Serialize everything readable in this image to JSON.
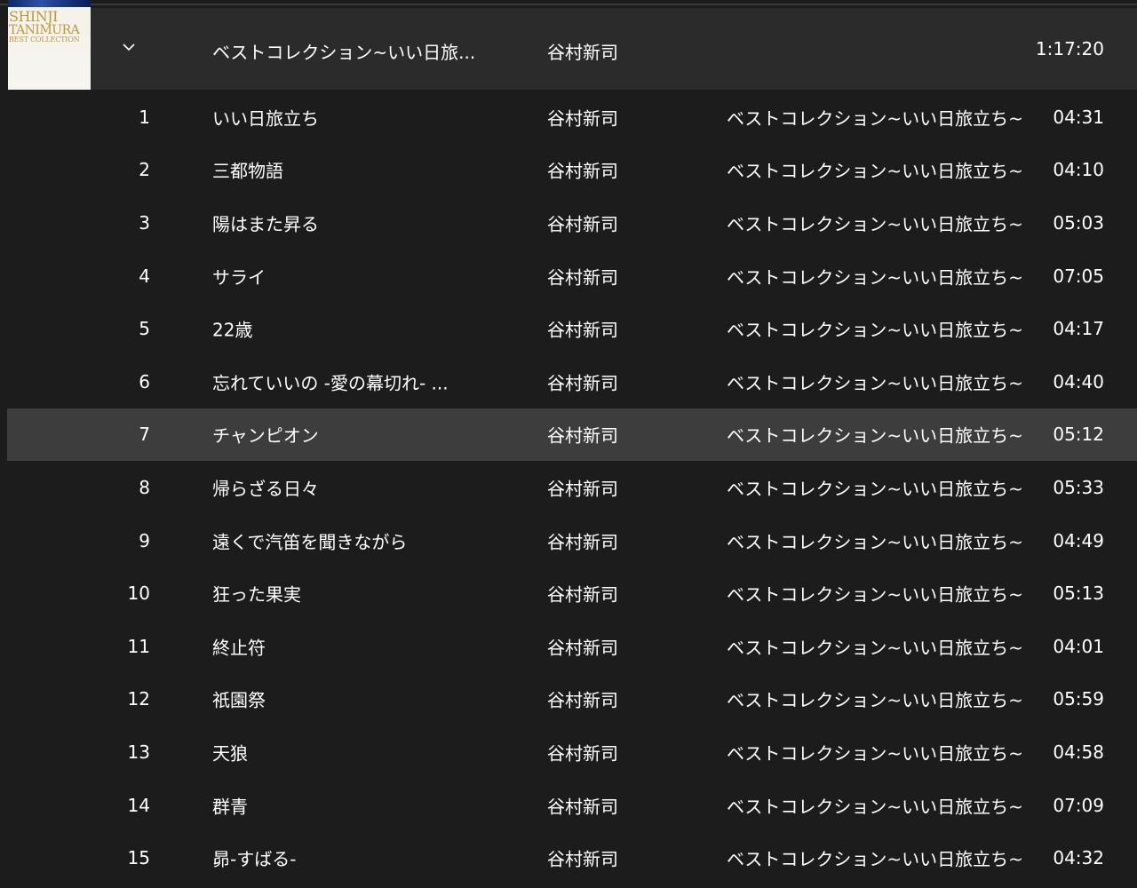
{
  "album": {
    "art_text": [
      "SHINJI",
      "TANIMURA",
      "BEST COLLECTION"
    ],
    "title": "ベストコレクション~いい日旅...",
    "artist": "谷村新司",
    "duration": "1:17:20",
    "expand_icon": "chevron-down-icon"
  },
  "columns": [
    "number",
    "title",
    "artist",
    "album",
    "duration"
  ],
  "selected_track": 7,
  "tracks": [
    {
      "number": "1",
      "title": "いい日旅立ち",
      "artist": "谷村新司",
      "album": "ベストコレクション~いい日旅立ち~",
      "duration": "04:31"
    },
    {
      "number": "2",
      "title": "三都物語",
      "artist": "谷村新司",
      "album": "ベストコレクション~いい日旅立ち~",
      "duration": "04:10"
    },
    {
      "number": "3",
      "title": "陽はまた昇る",
      "artist": "谷村新司",
      "album": "ベストコレクション~いい日旅立ち~",
      "duration": "05:03"
    },
    {
      "number": "4",
      "title": "サライ",
      "artist": "谷村新司",
      "album": "ベストコレクション~いい日旅立ち~",
      "duration": "07:05"
    },
    {
      "number": "5",
      "title": "22歳",
      "artist": "谷村新司",
      "album": "ベストコレクション~いい日旅立ち~",
      "duration": "04:17"
    },
    {
      "number": "6",
      "title": "忘れていいの -愛の幕切れ- ...",
      "artist": "谷村新司",
      "album": "ベストコレクション~いい日旅立ち~",
      "duration": "04:40"
    },
    {
      "number": "7",
      "title": "チャンピオン",
      "artist": "谷村新司",
      "album": "ベストコレクション~いい日旅立ち~",
      "duration": "05:12"
    },
    {
      "number": "8",
      "title": "帰らざる日々",
      "artist": "谷村新司",
      "album": "ベストコレクション~いい日旅立ち~",
      "duration": "05:33"
    },
    {
      "number": "9",
      "title": "遠くで汽笛を聞きながら",
      "artist": "谷村新司",
      "album": "ベストコレクション~いい日旅立ち~",
      "duration": "04:49"
    },
    {
      "number": "10",
      "title": "狂った果実",
      "artist": "谷村新司",
      "album": "ベストコレクション~いい日旅立ち~",
      "duration": "05:13"
    },
    {
      "number": "11",
      "title": "終止符",
      "artist": "谷村新司",
      "album": "ベストコレクション~いい日旅立ち~",
      "duration": "04:01"
    },
    {
      "number": "12",
      "title": "祇園祭",
      "artist": "谷村新司",
      "album": "ベストコレクション~いい日旅立ち~",
      "duration": "05:59"
    },
    {
      "number": "13",
      "title": "天狼",
      "artist": "谷村新司",
      "album": "ベストコレクション~いい日旅立ち~",
      "duration": "04:58"
    },
    {
      "number": "14",
      "title": "群青",
      "artist": "谷村新司",
      "album": "ベストコレクション~いい日旅立ち~",
      "duration": "07:09"
    },
    {
      "number": "15",
      "title": "昴-すばる-",
      "artist": "谷村新司",
      "album": "ベストコレクション~いい日旅立ち~",
      "duration": "04:32"
    }
  ],
  "colors": {
    "background": "#1c1c1c",
    "header_background": "#2b2b2b",
    "selected_row": "#3d3d3d",
    "text": "#ffffff"
  }
}
